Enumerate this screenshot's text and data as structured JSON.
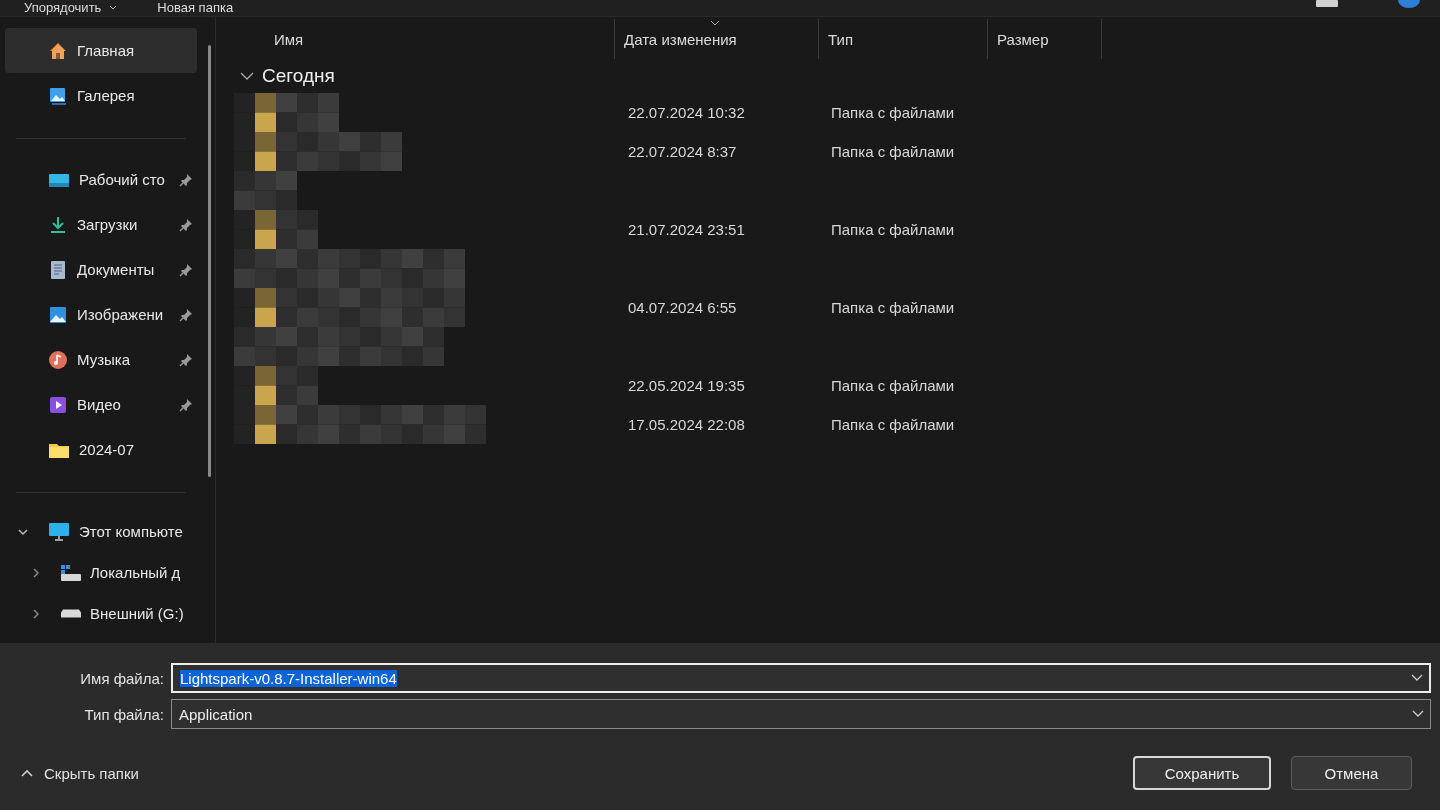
{
  "toolbar": {
    "buttons": [
      {
        "label": "Упорядочить",
        "kind": "menu"
      },
      {
        "label": "Новая папка",
        "kind": "plain"
      }
    ]
  },
  "sidebar": {
    "quick_access": [
      {
        "label": "Главная",
        "kind": "home",
        "selected": true
      },
      {
        "label": "Галерея",
        "kind": "gallery",
        "selected": false
      }
    ],
    "pinned": [
      {
        "label": "Рабочий сто",
        "kind": "desktop",
        "selected": false,
        "pinned": true
      },
      {
        "label": "Загрузки",
        "kind": "downloads",
        "selected": false,
        "pinned": true
      },
      {
        "label": "Документы",
        "kind": "documents",
        "selected": false,
        "pinned": true
      },
      {
        "label": "Изображени",
        "kind": "pictures",
        "selected": false,
        "pinned": true
      },
      {
        "label": "Музыка",
        "kind": "music",
        "selected": false,
        "pinned": true
      },
      {
        "label": "Видео",
        "kind": "video",
        "selected": false,
        "pinned": true
      },
      {
        "label": "2024-07",
        "kind": "folder",
        "selected": false,
        "pinned": false
      }
    ],
    "tree": [
      {
        "label": "Этот компьюте",
        "kind": "computer",
        "expanded": true,
        "children": [
          {
            "label": "Локальный д",
            "kind": "local-drive",
            "expanded": false
          },
          {
            "label": "Внешний (G:)",
            "kind": "external-drive",
            "expanded": false
          }
        ]
      }
    ]
  },
  "table": {
    "columns": [
      {
        "label": "Имя",
        "sorted": false
      },
      {
        "label": "Дата изменения",
        "sorted": true
      },
      {
        "label": "Тип",
        "sorted": false
      },
      {
        "label": "Размер",
        "sorted": false
      }
    ],
    "group": {
      "label": "Сегодня",
      "expanded": true
    },
    "rows": [
      {
        "kind": "entry",
        "date": "22.07.2024 10:32",
        "type": "Папка с файлами"
      },
      {
        "kind": "entry",
        "date": "22.07.2024 8:37",
        "type": "Папка с файлами"
      },
      {
        "kind": "blurred"
      },
      {
        "kind": "entry",
        "date": "21.07.2024 23:51",
        "type": "Папка с файлами"
      },
      {
        "kind": "blurred"
      },
      {
        "kind": "entry",
        "date": "04.07.2024 6:55",
        "type": "Папка с файлами"
      },
      {
        "kind": "blurred"
      },
      {
        "kind": "entry",
        "date": "22.05.2024 19:35",
        "type": "Папка с файлами"
      },
      {
        "kind": "entry",
        "date": "17.05.2024 22:08",
        "type": "Папка с файлами"
      }
    ]
  },
  "footer": {
    "file_name": {
      "label": "Имя файла:",
      "value": "Lightspark-v0.8.7-Installer-win64",
      "text_selected": true
    },
    "file_type": {
      "label": "Тип файла:",
      "value": "Application"
    },
    "hide_folders": {
      "label": "Скрыть папки",
      "expanded": true
    },
    "buttons": [
      {
        "label": "Сохранить",
        "default": true
      },
      {
        "label": "Отмена",
        "default": false
      }
    ]
  }
}
